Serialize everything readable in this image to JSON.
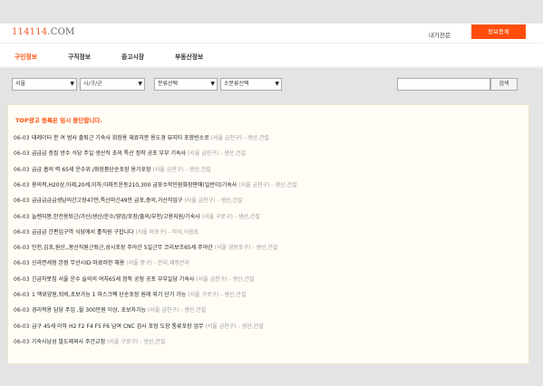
{
  "header": {
    "logo_brand": "114114",
    "logo_domain": ".COM",
    "my_request": "내가전문",
    "register_button": "정보등록"
  },
  "nav": {
    "tabs": [
      "구인정보",
      "구직정보",
      "중고시장",
      "부동산정보"
    ],
    "active": "구인정보"
  },
  "filters": {
    "region": "서울",
    "district": "시/구/군",
    "category": "분류선택",
    "subcategory": "소분류선택",
    "search_placeholder": "",
    "search_button": "검색"
  },
  "colors": {
    "accent": "#ff4e0a",
    "logo": "#f15a22",
    "background": "#e4e4e4",
    "panel": "#fffdf6"
  },
  "notice": "TOP광고 등록은 임시 중단합니다.",
  "listings": [
    {
      "date": "06-03",
      "title": "태레이터 분 여 범사 출퇴근 기숙사 회장용 재료처분 용도경 뷰지티 포함빈소로",
      "loc": "(서울 금천구)",
      "cat": "- 생산,건설"
    },
    {
      "date": "06-03",
      "title": "급급급 증집 방수 식당 주일 생산직 초의 특산 정착 공포 부부 기숙사",
      "loc": "(서울 금천구)",
      "cat": "- 생산,건설"
    },
    {
      "date": "06-03",
      "title": "급급 흡의 력 65세 운수위 /화장품단순포장 용기포장",
      "loc": "(서울 금천구)",
      "cat": "- 생산,건설"
    },
    {
      "date": "06-03",
      "title": "용의적,H20상,아제,20세,이하,아파트운동210,300 급포수학인원화장판매(일반이)기숙사",
      "loc": "(서울 금천구)",
      "cat": "- 생산,건설"
    },
    {
      "date": "06-03",
      "title": "급급급급급생남의간고장47만,특산마긴49만 급포,층의,가산직업구",
      "loc": "(서울 금천구)",
      "cat": "- 생산,건설"
    },
    {
      "date": "06-03",
      "title": "늘렌자봉,안전용퇴근/가산/생산/운수/영업/포장/출의/부천/고용지원/기숙사",
      "loc": "(서울 구로구)",
      "cat": "- 생산,건설"
    },
    {
      "date": "06-03",
      "title": "급급급 간편입구역 식당에서 홀직원 구합니다",
      "loc": "(서울 마포구)",
      "cat": "- 외식,식음료"
    },
    {
      "date": "06-03",
      "title": "인천,김포,원산,,봉산직원근퇴근,성시포장 주야간 5일근무 코리보조65세 주야간",
      "loc": "(서울 영등포구)",
      "cat": "- 생산,건설"
    },
    {
      "date": "06-03",
      "title": "신라면세점 본점 무선시ID 마료러한 채용",
      "loc": "(서울 중구)",
      "cat": "- 관리,재정관리"
    },
    {
      "date": "06-03",
      "title": "긴급하못집 서울 운수 슬의의 여자65세 정착 공정 공포 부부일당 기숙사",
      "loc": "(서울 금천구)",
      "cat": "- 생산,건설"
    },
    {
      "date": "06-03",
      "title": "1 맥위양원,퇴비,초보가능 1 마스크팩 단순포장 원레 외기 단기 가능",
      "loc": "(서울 구로구)",
      "cat": "- 생산,건설"
    },
    {
      "date": "06-03",
      "title": "경리적용 담당 주임 ,월 300만원 이상, 초보자가능",
      "loc": "(서울 금천구)",
      "cat": "- 생산,건설"
    },
    {
      "date": "06-03",
      "title": "급구 45세 이하 H2 F2 F4 F5 F6 남여 CNC 검사 포장 도장 통류포장 업무",
      "loc": "(서울 금천구)",
      "cat": "- 생산,건설"
    },
    {
      "date": "06-03",
      "title": "기숙사남성 발도제외사 주간교정",
      "loc": "(서울 구로구)",
      "cat": "- 생산,건설"
    }
  ]
}
